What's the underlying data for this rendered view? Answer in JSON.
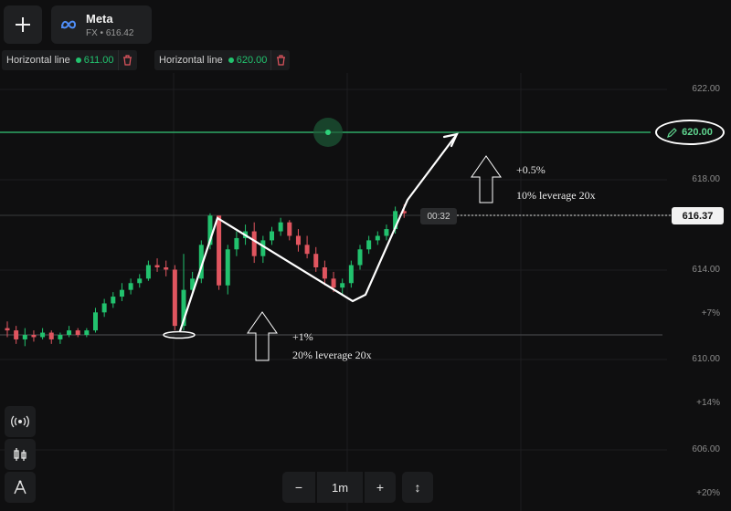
{
  "asset": {
    "name": "Meta",
    "sub": "FX • 616.42"
  },
  "horizontal_lines": [
    {
      "label": "Horizontal line",
      "value": "611.00"
    },
    {
      "label": "Horizontal line",
      "value": "620.00"
    }
  ],
  "price_axis": [
    "622.00",
    "618.00",
    "614.00",
    "+7%",
    "610.00",
    "+14%",
    "606.00",
    "+20%"
  ],
  "current_price": "616.37",
  "line_price": "620.00",
  "timer": "00:32",
  "annotations": {
    "upper_pct": "+0.5%",
    "upper_text": "10% leverage 20x",
    "lower_pct": "+1%",
    "lower_text": "20% leverage 20x"
  },
  "toolbar": {
    "minus": "−",
    "interval": "1m",
    "plus": "+",
    "expand": "↕"
  },
  "colors": {
    "up": "#22c26e",
    "down": "#e0555f",
    "line": "#2fa865"
  },
  "chart_data": {
    "type": "candlestick",
    "x_count": 46,
    "ylim": [
      605,
      623
    ],
    "candles": [
      [
        611.3,
        611.6,
        610.9,
        611.2
      ],
      [
        611.2,
        611.4,
        610.6,
        610.8
      ],
      [
        610.8,
        611.3,
        610.5,
        611.0
      ],
      [
        611.0,
        611.2,
        610.7,
        610.9
      ],
      [
        610.9,
        611.3,
        610.8,
        611.1
      ],
      [
        611.1,
        611.2,
        610.6,
        610.8
      ],
      [
        610.8,
        611.1,
        610.6,
        611.0
      ],
      [
        611.0,
        611.4,
        610.9,
        611.2
      ],
      [
        611.2,
        611.3,
        610.9,
        611.0
      ],
      [
        611.0,
        611.3,
        610.9,
        611.2
      ],
      [
        611.2,
        612.2,
        611.1,
        612.0
      ],
      [
        612.0,
        612.6,
        611.8,
        612.4
      ],
      [
        612.4,
        612.9,
        612.2,
        612.7
      ],
      [
        612.7,
        613.3,
        612.5,
        613.0
      ],
      [
        613.0,
        613.5,
        612.8,
        613.3
      ],
      [
        613.3,
        613.7,
        613.1,
        613.5
      ],
      [
        613.5,
        614.3,
        613.4,
        614.1
      ],
      [
        614.1,
        614.4,
        613.8,
        614.0
      ],
      [
        614.0,
        614.3,
        613.6,
        613.9
      ],
      [
        613.9,
        614.1,
        611.2,
        611.4
      ],
      [
        611.4,
        614.6,
        611.2,
        613.0
      ],
      [
        613.0,
        613.8,
        612.8,
        613.5
      ],
      [
        613.5,
        615.2,
        613.3,
        615.0
      ],
      [
        615.0,
        616.4,
        614.8,
        616.3
      ],
      [
        616.3,
        616.1,
        613.0,
        613.2
      ],
      [
        613.2,
        615.0,
        612.8,
        614.8
      ],
      [
        614.8,
        615.6,
        614.5,
        615.3
      ],
      [
        615.3,
        615.9,
        615.0,
        615.6
      ],
      [
        615.6,
        616.0,
        614.2,
        614.5
      ],
      [
        614.5,
        615.4,
        614.2,
        615.2
      ],
      [
        615.2,
        615.8,
        615.0,
        615.6
      ],
      [
        615.6,
        616.2,
        615.4,
        616.0
      ],
      [
        616.0,
        616.1,
        615.2,
        615.4
      ],
      [
        615.4,
        615.7,
        614.7,
        615.0
      ],
      [
        615.0,
        615.4,
        614.4,
        614.6
      ],
      [
        614.6,
        614.9,
        613.8,
        614.0
      ],
      [
        614.0,
        614.3,
        613.2,
        613.5
      ],
      [
        613.5,
        613.8,
        612.9,
        613.1
      ],
      [
        613.1,
        613.5,
        612.8,
        613.3
      ],
      [
        613.3,
        614.3,
        613.1,
        614.1
      ],
      [
        614.1,
        615.0,
        613.9,
        614.8
      ],
      [
        614.8,
        615.4,
        614.6,
        615.2
      ],
      [
        615.2,
        615.6,
        615.0,
        615.4
      ],
      [
        615.4,
        615.9,
        615.2,
        615.7
      ],
      [
        615.7,
        616.7,
        615.5,
        616.5
      ],
      [
        616.5,
        616.8,
        616.2,
        616.4
      ]
    ]
  }
}
